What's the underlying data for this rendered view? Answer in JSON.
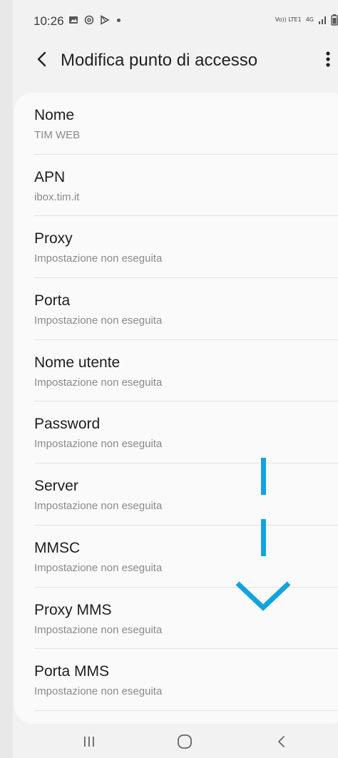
{
  "status_bar": {
    "time": "10:26",
    "left_icons": [
      "gallery-icon",
      "at-sign-icon",
      "play-store-icon",
      "notification-dot-icon"
    ],
    "right_icons": [
      "volte-icon",
      "4g-icon",
      "signal-icon",
      "battery-icon"
    ],
    "volte_label": "Vo)) LTE1",
    "network_label": "4G"
  },
  "app_bar": {
    "title": "Modifica punto di accesso"
  },
  "fields": [
    {
      "label": "Nome",
      "value": "TIM WEB"
    },
    {
      "label": "APN",
      "value": "ibox.tim.it"
    },
    {
      "label": "Proxy",
      "value": "Impostazione non eseguita"
    },
    {
      "label": "Porta",
      "value": "Impostazione non eseguita"
    },
    {
      "label": "Nome utente",
      "value": "Impostazione non eseguita"
    },
    {
      "label": "Password",
      "value": "Impostazione non eseguita"
    },
    {
      "label": "Server",
      "value": "Impostazione non eseguita"
    },
    {
      "label": "MMSC",
      "value": "Impostazione non eseguita"
    },
    {
      "label": "Proxy MMS",
      "value": "Impostazione non eseguita"
    },
    {
      "label": "Porta MMS",
      "value": "Impostazione non eseguita"
    }
  ],
  "nav_bar": {
    "buttons": [
      "recents-icon",
      "home-icon",
      "back-icon"
    ]
  },
  "colors": {
    "accent_indicator": "#11a3e0",
    "title_text": "#1e1e1e",
    "secondary_text": "#8a8a8a",
    "background": "#f2f2f2",
    "card": "#fafafa"
  }
}
